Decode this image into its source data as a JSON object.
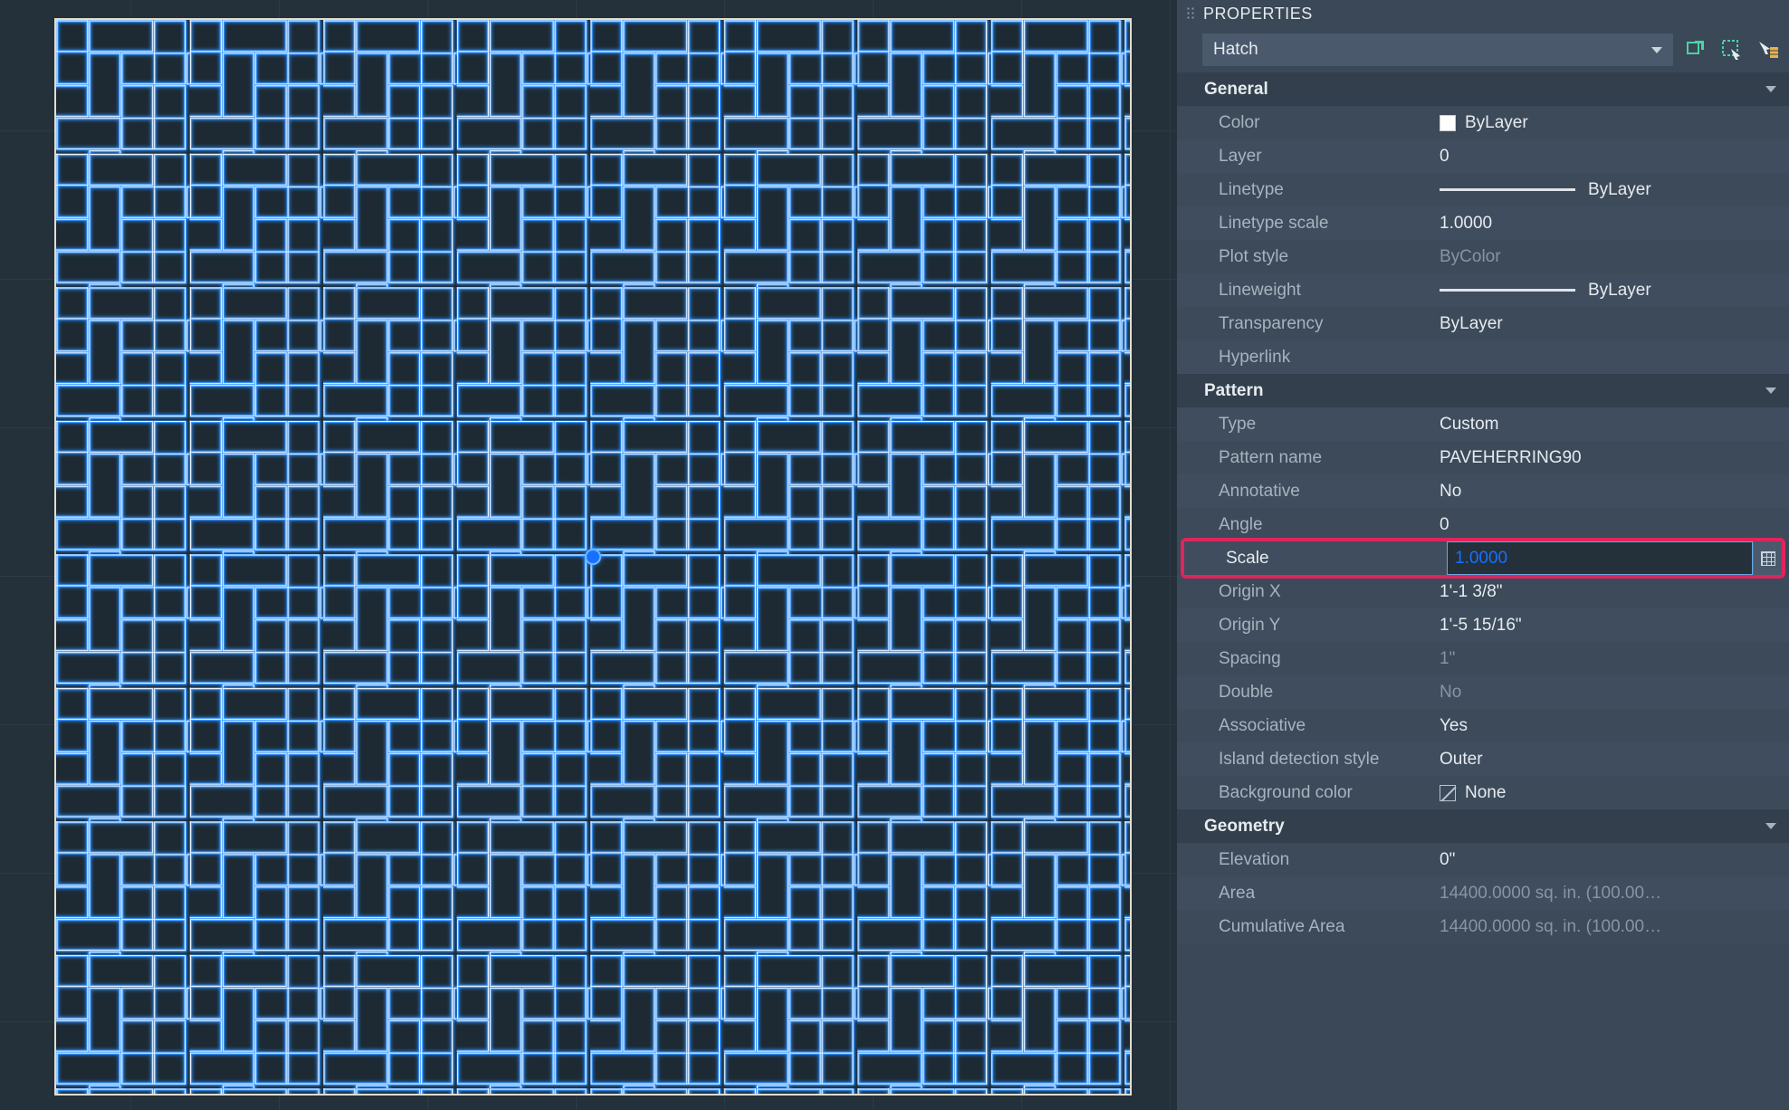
{
  "panel": {
    "title": "PROPERTIES",
    "object_type": "Hatch",
    "icons": {
      "toggle_pick": "toggle-pick-icon",
      "quick_select": "quick-select-icon",
      "prop_picker": "prop-picker-icon"
    }
  },
  "sections": {
    "general": {
      "title": "General",
      "color_label": "Color",
      "color_value": "ByLayer",
      "layer_label": "Layer",
      "layer_value": "0",
      "linetype_label": "Linetype",
      "linetype_value": "ByLayer",
      "linetype_scale_label": "Linetype scale",
      "linetype_scale_value": "1.0000",
      "plot_style_label": "Plot style",
      "plot_style_value": "ByColor",
      "lineweight_label": "Lineweight",
      "lineweight_value": "ByLayer",
      "transparency_label": "Transparency",
      "transparency_value": "ByLayer",
      "hyperlink_label": "Hyperlink",
      "hyperlink_value": ""
    },
    "pattern": {
      "title": "Pattern",
      "type_label": "Type",
      "type_value": "Custom",
      "pattern_name_label": "Pattern name",
      "pattern_name_value": "PAVEHERRING90",
      "annotative_label": "Annotative",
      "annotative_value": "No",
      "angle_label": "Angle",
      "angle_value": "0",
      "scale_label": "Scale",
      "scale_value": "1.0000",
      "origin_x_label": "Origin X",
      "origin_x_value": "1'-1 3/8\"",
      "origin_y_label": "Origin Y",
      "origin_y_value": "1'-5 15/16\"",
      "spacing_label": "Spacing",
      "spacing_value": "1\"",
      "double_label": "Double",
      "double_value": "No",
      "associative_label": "Associative",
      "associative_value": "Yes",
      "island_label": "Island detection style",
      "island_value": "Outer",
      "bg_label": "Background color",
      "bg_value": "None"
    },
    "geometry": {
      "title": "Geometry",
      "elevation_label": "Elevation",
      "elevation_value": "0\"",
      "area_label": "Area",
      "area_value": "14400.0000 sq. in. (100.00…",
      "cum_area_label": "Cumulative Area",
      "cum_area_value": "14400.0000 sq. in. (100.00…"
    }
  }
}
